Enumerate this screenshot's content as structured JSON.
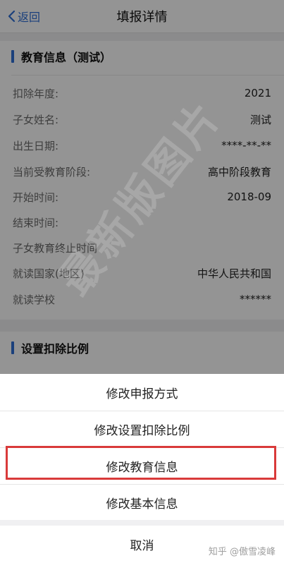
{
  "navbar": {
    "back_label": "返回",
    "title": "填报详情"
  },
  "education_section": {
    "title": "教育信息（测试）",
    "rows": [
      {
        "label": "扣除年度:",
        "value": "2021"
      },
      {
        "label": "子女姓名:",
        "value": "测试"
      },
      {
        "label": "出生日期:",
        "value": "****-**-**"
      },
      {
        "label": "当前受教育阶段:",
        "value": "高中阶段教育"
      },
      {
        "label": "开始时间:",
        "value": "2018-09"
      },
      {
        "label": "结束时间:",
        "value": ""
      },
      {
        "label": "子女教育终止时间",
        "value": ""
      },
      {
        "label": "就读国家(地区)",
        "value": "中华人民共和国"
      },
      {
        "label": "就读学校",
        "value": "******"
      }
    ]
  },
  "deduction_section": {
    "title": "设置扣除比例"
  },
  "action_sheet": {
    "items": [
      {
        "label": "修改申报方式"
      },
      {
        "label": "修改设置扣除比例"
      },
      {
        "label": "修改教育信息"
      },
      {
        "label": "修改基本信息"
      }
    ],
    "cancel_label": "取消"
  },
  "watermark_text": "最新版图片",
  "credit_text": "知乎 @傲雪凌峰",
  "colors": {
    "accent": "#2f6fd6",
    "highlight": "#d93a3a"
  }
}
